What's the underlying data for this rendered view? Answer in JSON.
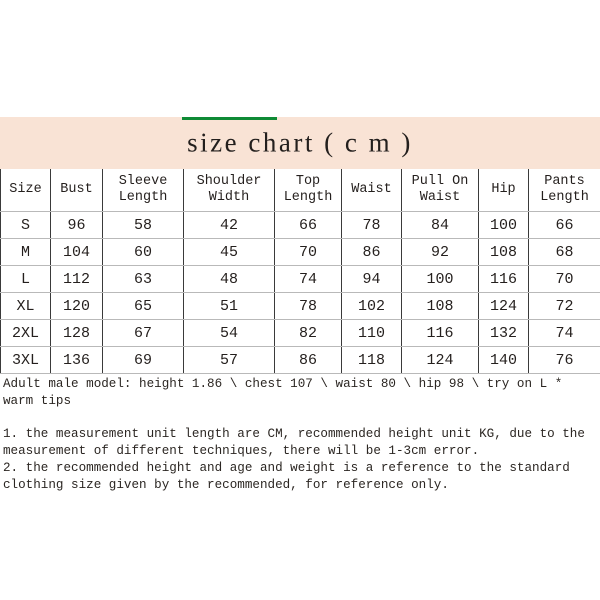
{
  "banner": {
    "title": "size chart ( c m )",
    "accent_color": "#0e8a35",
    "background_color": "#f9e3d5"
  },
  "table": {
    "columns": [
      "Size",
      "Bust",
      "Sleeve\nLength",
      "Shoulder\nWidth",
      "Top\nLength",
      "Waist",
      "Pull On\nWaist",
      "Hip",
      "Pants\nLength"
    ],
    "rows": [
      {
        "cells": [
          "S",
          "96",
          "58",
          "42",
          "66",
          "78",
          "84",
          "100",
          "66"
        ]
      },
      {
        "cells": [
          "M",
          "104",
          "60",
          "45",
          "70",
          "86",
          "92",
          "108",
          "68"
        ]
      },
      {
        "cells": [
          "L",
          "112",
          "63",
          "48",
          "74",
          "94",
          "100",
          "116",
          "70"
        ]
      },
      {
        "cells": [
          "XL",
          "120",
          "65",
          "51",
          "78",
          "102",
          "108",
          "124",
          "72"
        ]
      },
      {
        "cells": [
          "2XL",
          "128",
          "67",
          "54",
          "82",
          "110",
          "116",
          "132",
          "74"
        ]
      },
      {
        "cells": [
          "3XL",
          "136",
          "69",
          "57",
          "86",
          "118",
          "124",
          "140",
          "76"
        ]
      }
    ]
  },
  "notes": {
    "model": "Adult male model: height 1.86 \\ chest 107 \\ waist 80 \\ hip 98 \\ try on L * warm tips",
    "items": [
      "1. the measurement unit length are CM, recommended height unit KG, due to the measurement of different techniques, there will be 1-3cm error.",
      "2. the recommended height and age and weight is a reference to the standard clothing size given by the recommended, for reference only."
    ]
  }
}
